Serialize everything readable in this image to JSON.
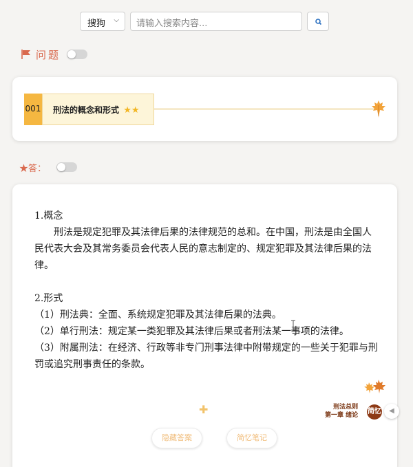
{
  "search": {
    "engine": "搜狗",
    "placeholder": "请输入搜索内容...",
    "button_icon": "search-icon"
  },
  "question_section": {
    "title": "问题",
    "icon": "flag-icon",
    "toggle_on": false
  },
  "question": {
    "number": "001",
    "title": "刑法的概念和形式",
    "stars": "★★",
    "star_count": 2,
    "decor_icon": "maple-leaf-icon"
  },
  "answer_section": {
    "title": "★答：",
    "toggle_on": false
  },
  "answer": {
    "lines": [
      "1.概念",
      "刑法是规定犯罪及其法律后果的法律规范的总和。在中国，刑法是由全国人民代表大会及其常务委员会代表人民的意志制定的、规定犯罪及其法律后果的法律。",
      "",
      "2.形式",
      "（1）刑法典：全面、系统规定犯罪及其法律后果的法典。",
      "（2）单行刑法：规定某一类犯罪及其法律后果或者刑法某一事项的法律。",
      "（3）附属刑法：在经济、行政等非专门刑事法律中附带规定的一些关于犯罪与刑罚或追究刑事责任的条款。"
    ]
  },
  "tag": {
    "line1": "刑法总则",
    "line2": "第一章 绪论",
    "brand": "简忆"
  },
  "buttons": {
    "hide_answer": "隐藏答案",
    "notes": "简忆笔记"
  },
  "colors": {
    "accent": "#d9694e",
    "number_bg": "#f5b741",
    "title_bg": "#fdf5d9",
    "brand": "#8d3a16",
    "button_text": "#f0bc7a"
  }
}
